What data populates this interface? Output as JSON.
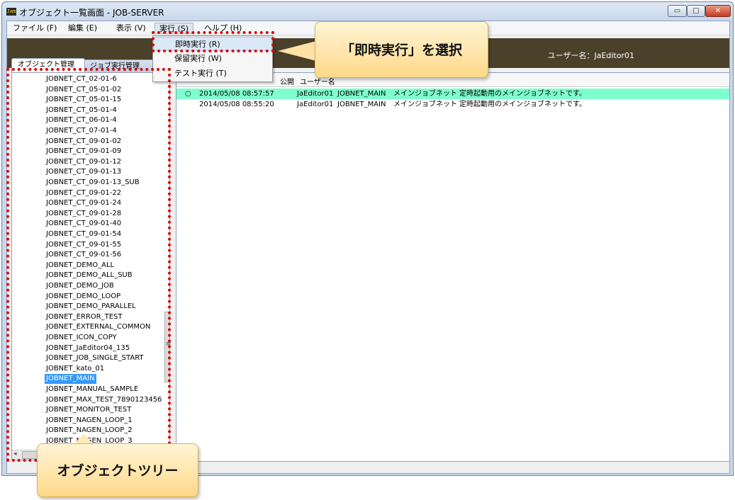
{
  "window": {
    "icon_text": "Jam",
    "title": "オブジェクト一覧画面 - JOB-SERVER",
    "min_glyph": "▭",
    "max_glyph": "□",
    "close_glyph": "✕"
  },
  "menubar": {
    "items": [
      "ファイル (F)",
      "編集 (E)",
      "表示 (V)",
      "実行 (S)",
      "ヘルプ (H)"
    ]
  },
  "banner": {
    "user_label": "ユーザー名：JaEditor01"
  },
  "tabs": {
    "object_management": "オブジェクト管理",
    "job_execution_management": "ジョブ実行管理"
  },
  "run_menu": {
    "items": [
      "即時実行 (R)",
      "保留実行 (W)",
      "テスト実行 (T)"
    ]
  },
  "tree": {
    "items": [
      "JOBNET_CT_02-01-6",
      "JOBNET_CT_05-01-02",
      "JOBNET_CT_05-01-15",
      "JOBNET_CT_05-01-4",
      "JOBNET_CT_06-01-4",
      "JOBNET_CT_07-01-4",
      "JOBNET_CT_09-01-02",
      "JOBNET_CT_09-01-09",
      "JOBNET_CT_09-01-12",
      "JOBNET_CT_09-01-13",
      "JOBNET_CT_09-01-13_SUB",
      "JOBNET_CT_09-01-22",
      "JOBNET_CT_09-01-24",
      "JOBNET_CT_09-01-28",
      "JOBNET_CT_09-01-40",
      "JOBNET_CT_09-01-54",
      "JOBNET_CT_09-01-55",
      "JOBNET_CT_09-01-56",
      "JOBNET_DEMO_ALL",
      "JOBNET_DEMO_ALL_SUB",
      "JOBNET_DEMO_JOB",
      "JOBNET_DEMO_LOOP",
      "JOBNET_DEMO_PARALLEL",
      "JOBNET_ERROR_TEST",
      "JOBNET_EXTERNAL_COMMON",
      "JOBNET_ICON_COPY",
      "JOBNET_JaEditor04_135",
      "JOBNET_JOB_SINGLE_START",
      "JOBNET_kato_01",
      "JOBNET_MAIN",
      "JOBNET_MANUAL_SAMPLE",
      "JOBNET_MAX_TEST_7890123456",
      "JOBNET_MONITOR_TEST",
      "JOBNET_NAGEN_LOOP_1",
      "JOBNET_NAGEN_LOOP_2",
      "JOBNET_NAGEN_LOOP_3"
    ],
    "selected": "JOBNET_MAIN",
    "scroll_left_arrow": "◂",
    "splitter_grip": "≡"
  },
  "grid": {
    "headers": [
      "公開",
      "ユーザー名"
    ],
    "rows": [
      {
        "marker": "○",
        "updated": "2014/05/08 08:57:57",
        "user": "JaEditor01",
        "id": "JOBNET_MAIN",
        "name": "メインジョブネット",
        "description": "定時起動用のメインジョブネットです。"
      },
      {
        "marker": "",
        "updated": "2014/05/08 08:55:20",
        "user": "JaEditor01",
        "id": "JOBNET_MAIN",
        "name": "メインジョブネット",
        "description": "定時起動用のメインジョブネットです。"
      }
    ]
  },
  "annotations": {
    "callout_run": "「即時実行」を選択",
    "callout_tree": "オブジェクトツリー"
  }
}
